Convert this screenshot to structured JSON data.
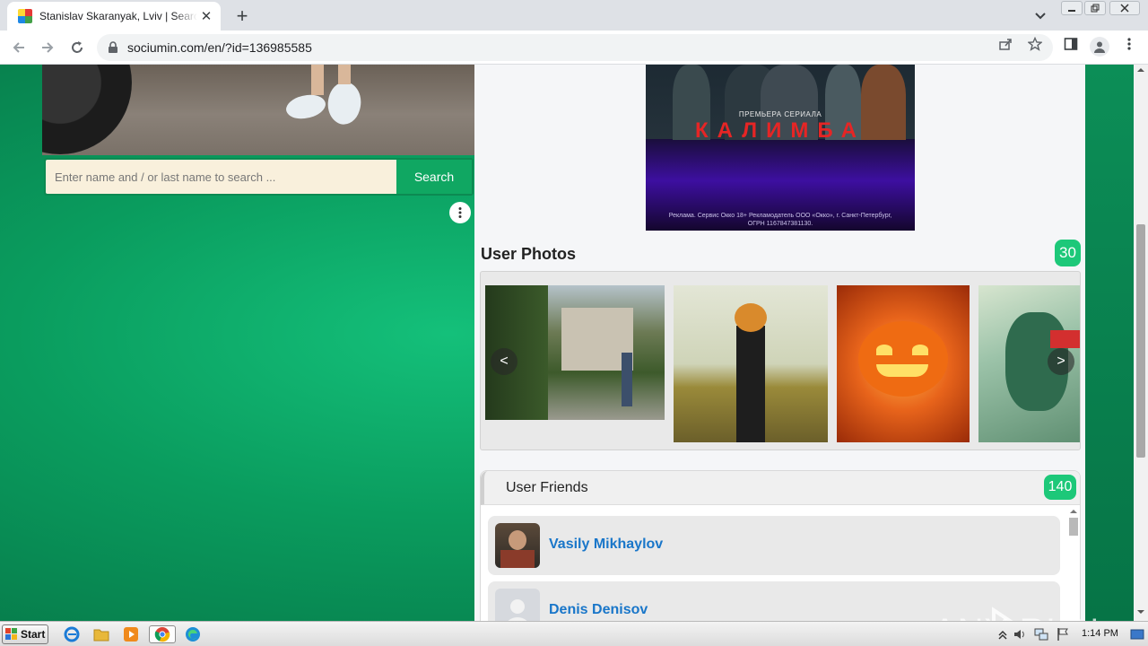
{
  "browser": {
    "tab_title": "Stanislav Skaranyak, Lviv | Search Images",
    "url": "sociumin.com/en/?id=136985585",
    "new_tab": "+",
    "tab_close": "✕"
  },
  "search": {
    "placeholder": "Enter name and / or last name to search ...",
    "button_label": "Search"
  },
  "ad": {
    "caption": "ПРЕМЬЕРА СЕРИАЛА",
    "brand": "КАЛИМБА",
    "legal": "Реклама. Сервис Окко 18+ Рекламодатель ООО «Окко», г. Санкт-Петербург, ОГРН 1167847381130."
  },
  "photos": {
    "title": "User Photos",
    "count": "30",
    "prev": "<",
    "next": ">"
  },
  "friends": {
    "title": "User Friends",
    "count": "140",
    "items": [
      {
        "name": "Vasily Mikhaylov"
      },
      {
        "name": "Denis Denisov"
      }
    ]
  },
  "watermark": "ANY RUN",
  "taskbar": {
    "start_label": "Start",
    "clock": "1:14 PM"
  }
}
